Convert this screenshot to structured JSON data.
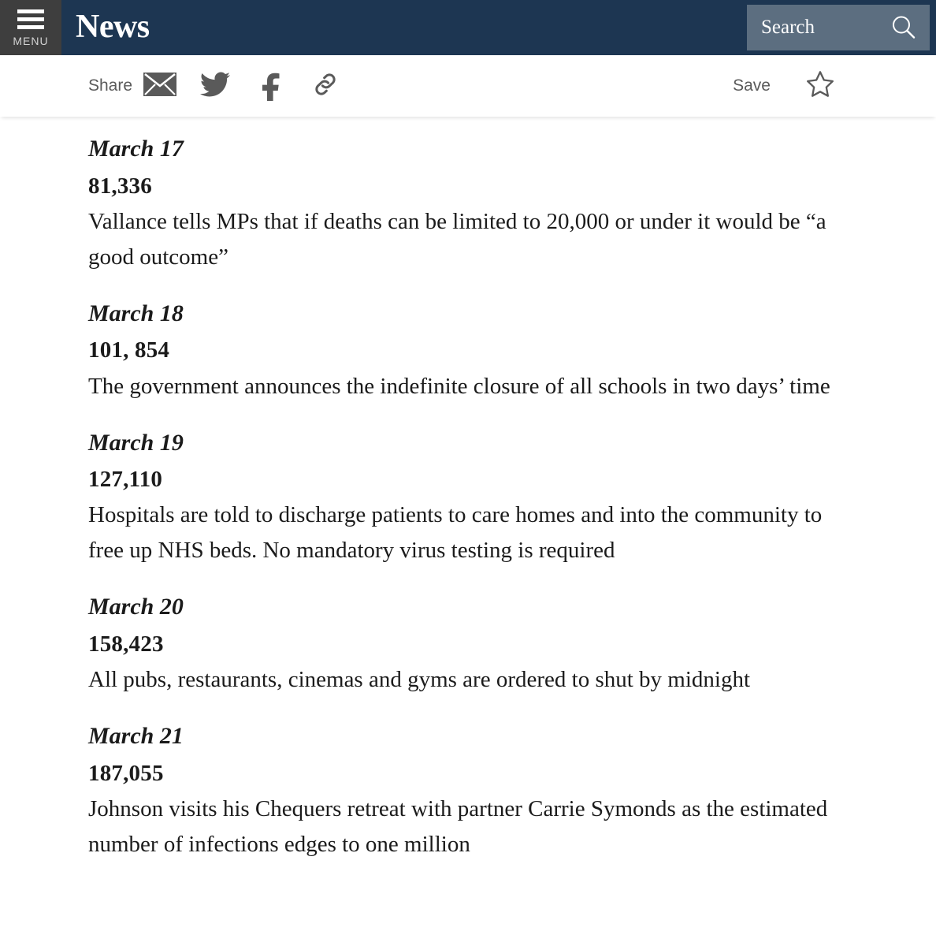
{
  "header": {
    "menu_label": "MENU",
    "brand_title": "News",
    "search_placeholder": "Search",
    "search_value": "",
    "bar_color": "#1d3652",
    "menu_block_color": "#3e3e3e",
    "search_box_color": "#5c6e80"
  },
  "sharebar": {
    "share_label": "Share",
    "save_label": "Save",
    "icon_color": "#5a5a5a",
    "icons": [
      {
        "name": "email-icon",
        "title": "Share by email"
      },
      {
        "name": "twitter-icon",
        "title": "Share on Twitter"
      },
      {
        "name": "facebook-icon",
        "title": "Share on Facebook"
      },
      {
        "name": "link-icon",
        "title": "Copy link"
      }
    ],
    "save_icon": {
      "name": "star-icon",
      "title": "Save article"
    }
  },
  "article": {
    "entries": [
      {
        "date": "March 17",
        "count": "81,336",
        "text": "Vallance tells MPs that if deaths can be limited to 20,000 or under it would be “a good outcome”"
      },
      {
        "date": "March 18",
        "count": "101, 854",
        "text": "The government announces the indefinite closure of all schools in two days’ time"
      },
      {
        "date": "March 19",
        "count": "127,110",
        "text": "Hospitals are told to discharge patients to care homes and into the community to free up NHS beds. No mandatory virus testing is required"
      },
      {
        "date": "March 20",
        "count": "158,423",
        "text": "All pubs, restaurants, cinemas and gyms are ordered to shut by midnight"
      },
      {
        "date": "March 21",
        "count": "187,055",
        "text": "Johnson visits his Chequers retreat with partner Carrie Symonds as the estimated number of infections edges to one million"
      }
    ]
  }
}
